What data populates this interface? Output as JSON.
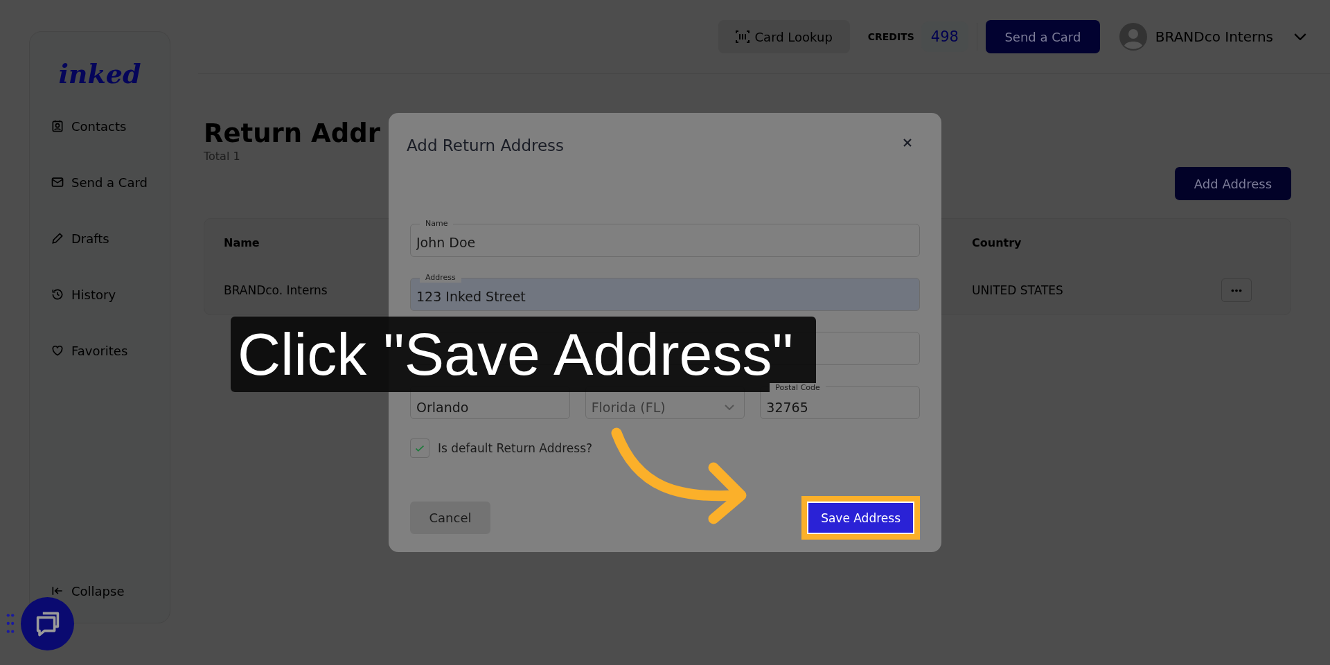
{
  "sidebar": {
    "logo": "inked",
    "items": [
      {
        "label": "Contacts"
      },
      {
        "label": "Send a Card"
      },
      {
        "label": "Drafts"
      },
      {
        "label": "History"
      },
      {
        "label": "Favorites"
      }
    ],
    "collapse": "Collapse"
  },
  "topbar": {
    "lookup": "Card Lookup",
    "credits_label": "CREDITS",
    "credits": "498",
    "send": "Send a Card",
    "user": "BRANDco Interns"
  },
  "page": {
    "title": "Return Addr",
    "total": "Total 1",
    "add_button": "Add Address"
  },
  "table": {
    "columns": [
      "Name",
      "Country"
    ],
    "rows": [
      {
        "name": "BRANDco. Interns",
        "country": "UNITED STATES"
      }
    ]
  },
  "modal": {
    "title": "Add Return Address",
    "fields": [
      {
        "label": "Name",
        "value": "John Doe",
        "autofilled": false
      },
      {
        "label": "Address",
        "value": "123 Inked Street",
        "autofilled": true
      },
      {
        "autofilled": false
      }
    ],
    "row_fields": [
      {
        "kind": "text",
        "value": "Orlando"
      },
      {
        "kind": "select",
        "value": "Florida (FL)"
      },
      {
        "kind": "text",
        "label": "Postal Code",
        "value": "32765"
      }
    ],
    "default_checkbox": {
      "label": "Is default Return Address?",
      "checked": true
    },
    "cancel": "Cancel",
    "save": {
      "label": "Save Address",
      "highlighted": true
    }
  },
  "callout": "Click \"Save Address\""
}
